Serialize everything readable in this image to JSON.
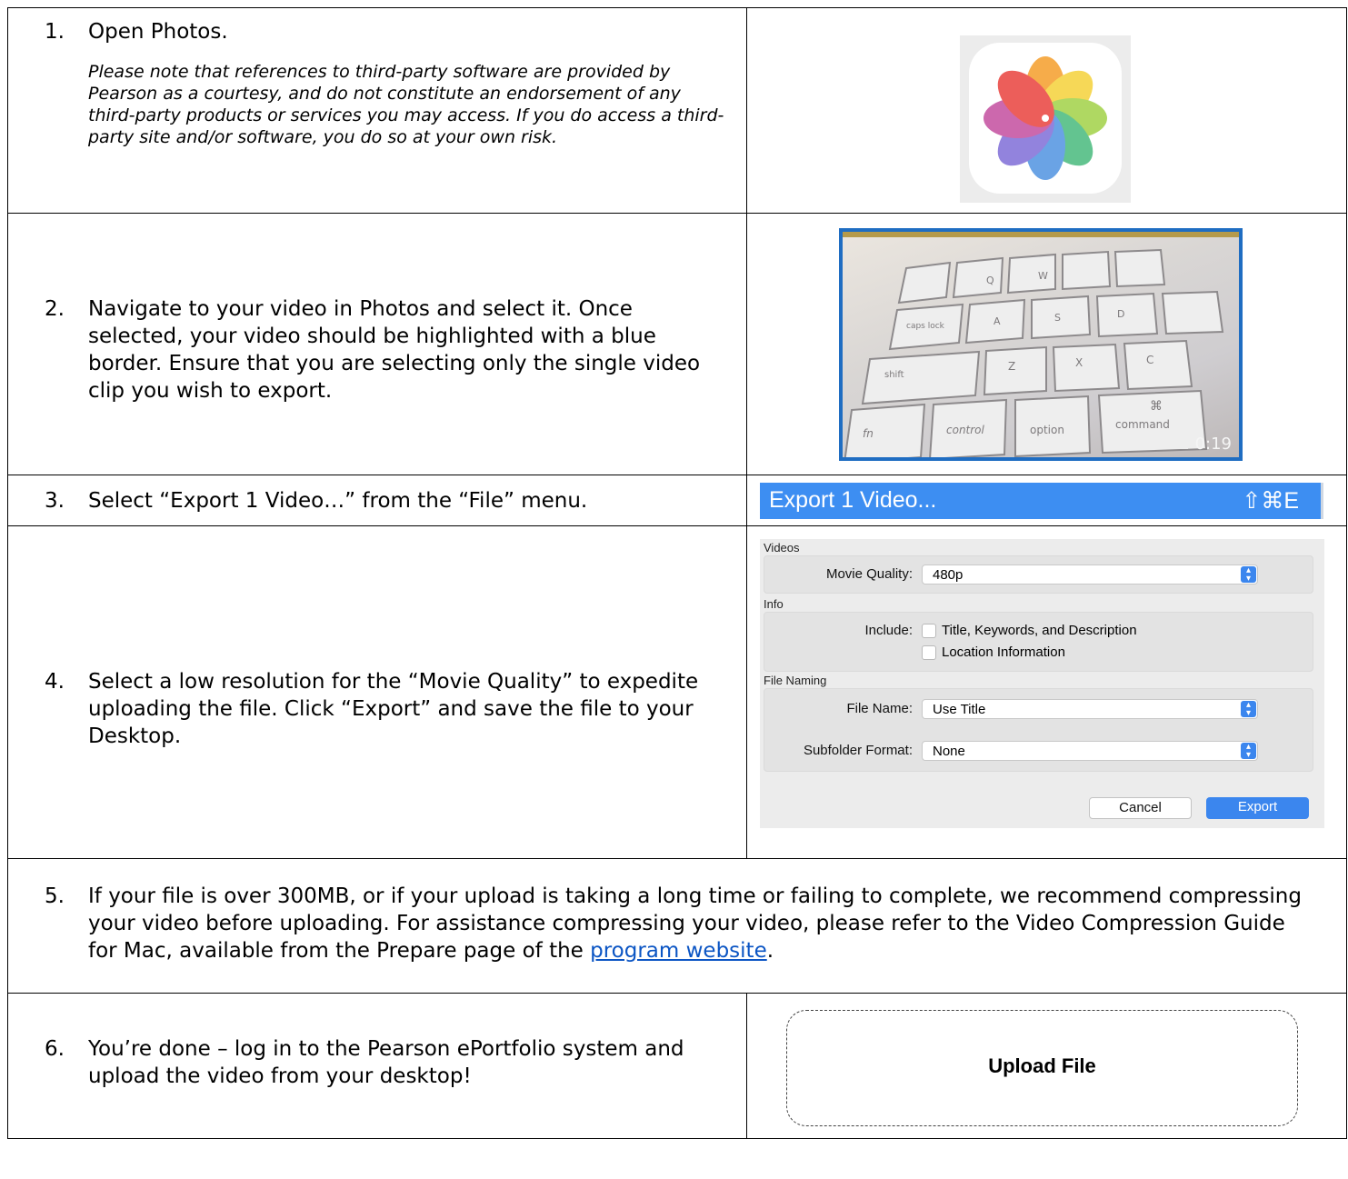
{
  "steps": [
    {
      "num": "1.",
      "text": "Open Photos.",
      "note": "Please note that references to third-party software are provided by Pearson as a courtesy, and do not constitute an endorsement of any third-party products or services you may access. If you do access a third-party site and/or software, you do so at your own risk."
    },
    {
      "num": "2.",
      "text": "Navigate to your video in Photos and select it. Once selected, your video should be highlighted with a blue border. Ensure that you are selecting only the single video clip you wish to export."
    },
    {
      "num": "3.",
      "text": "Select “Export 1 Video…” from the “File” menu."
    },
    {
      "num": "4.",
      "text": "Select a low resolution for the “Movie Quality” to expedite uploading the file. Click “Export” and save the file to your Desktop."
    },
    {
      "num": "5.",
      "text_before_link": "If your file is over 300MB, or if your upload is taking a long time or failing to complete, we recommend compressing your video before uploading. For assistance compressing your video, please refer to the Video Compression Guide for Mac, available from the Prepare page of the ",
      "link_text": "program website",
      "text_after_link": "."
    },
    {
      "num": "6.",
      "text": "You’re done – log in to the Pearson ePortfolio system and upload the video from your desktop!"
    }
  ],
  "video_thumb": {
    "duration": "0:19",
    "keys": [
      "Q",
      "W",
      "A",
      "S",
      "D",
      "Z",
      "X",
      "C",
      "caps lock",
      "shift",
      "fn",
      "control",
      "option",
      "command",
      "⌘"
    ]
  },
  "menu": {
    "label": "Export 1 Video...",
    "shortcut": "⇧⌘E"
  },
  "export_dialog": {
    "videos_section": "Videos",
    "movie_quality_label": "Movie Quality:",
    "movie_quality_value": "480p",
    "info_section": "Info",
    "include_label": "Include:",
    "include_options": [
      "Title, Keywords, and Description",
      "Location Information"
    ],
    "file_naming_section": "File Naming",
    "file_name_label": "File Name:",
    "file_name_value": "Use Title",
    "subfolder_label": "Subfolder Format:",
    "subfolder_value": "None",
    "cancel_label": "Cancel",
    "export_label": "Export",
    "accent_color": "#3b86ee"
  },
  "upload": {
    "label": "Upload File"
  }
}
